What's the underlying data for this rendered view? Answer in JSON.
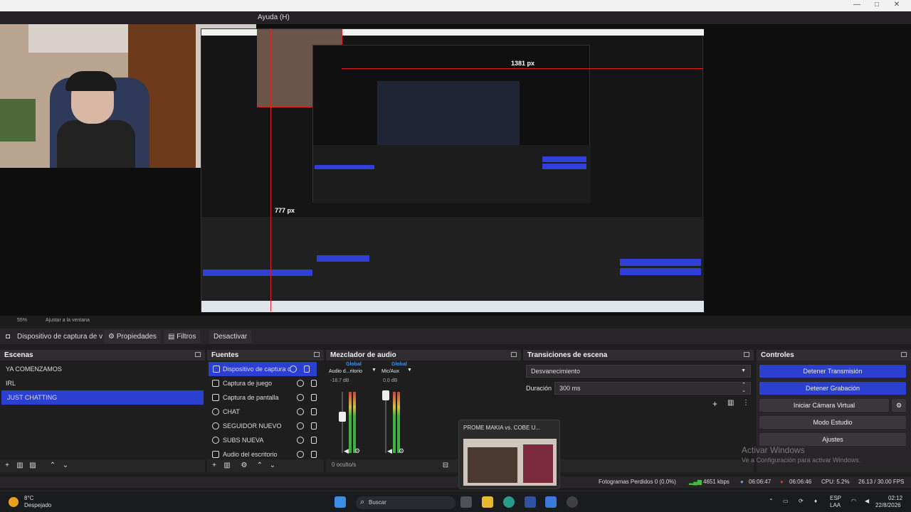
{
  "window": {
    "menu_item": "Ayuda (H)"
  },
  "preview": {
    "measure_h": "1381 px",
    "measure_v": "777 px",
    "nested_menu": "Ayuda (H)"
  },
  "zoom_bar": {
    "zoom": "55%",
    "fit": "Ajustar a la ventana"
  },
  "source_toolbar": {
    "source_name": "Dispositivo de captura de v",
    "properties": "Propiedades",
    "filters": "Filtros",
    "deactivate": "Desactivar"
  },
  "scenes": {
    "title": "Escenas",
    "items": [
      "YA COMENZAMOS",
      "IRL",
      "JUST CHATTING"
    ],
    "selected": 2
  },
  "sources": {
    "title": "Fuentes",
    "items": [
      "Dispositivo de captura c",
      "Captura de juego",
      "Captura de pantalla",
      "CHAT",
      "SEGUIDOR NUEVO",
      "SUBS NUEVA",
      "Audio del escritorio"
    ]
  },
  "mixer": {
    "title": "Mezclador de audio",
    "ch1": {
      "header": "Global",
      "name": "Audio d...ritorio",
      "db": "-18.7 dB"
    },
    "ch2": {
      "header": "Global",
      "name": "Mic/Aux",
      "db": "0.0 dB"
    },
    "hidden": "0 oculto/s",
    "scale": [
      "0",
      "-6",
      "-12",
      "-18",
      "-24",
      "-30",
      "-36",
      "-42",
      "-48",
      "-54",
      "-60"
    ]
  },
  "transitions": {
    "title": "Transiciones de escena",
    "transition": "Desvanecimiento",
    "duration_label": "Duración",
    "duration_value": "300 ms"
  },
  "controls": {
    "title": "Controles",
    "stop_stream": "Detener Transmisión",
    "stop_record": "Detener Grabación",
    "virtual_cam": "Iniciar Cámara Virtual",
    "studio_mode": "Modo Estudio",
    "settings": "Ajustes"
  },
  "thumbnail": {
    "title": "PROME MAKIA vs. COBE U..."
  },
  "watermark": {
    "line1": "Activar Windows",
    "line2": "Ve a Configuración para activar Windows."
  },
  "statusbar": {
    "dropped": "Fotogramas Perdidos 0 (0.0%)",
    "bitrate": "4651 kbps",
    "stream_time": "06:06:47",
    "rec_time": "06:06:46",
    "cpu": "CPU: 5.2%",
    "fps": "26.13 / 30.00 FPS"
  },
  "taskbar": {
    "weather_temp": "8°C",
    "weather_desc": "Despejado",
    "search": "Buscar",
    "lang1": "ESP",
    "lang2": "LAA",
    "time": "02:12",
    "date": "22/8/2026"
  },
  "colors": {
    "accent": "#2b3fd1",
    "measure": "#e02020",
    "bg": "#1f1e1f"
  }
}
